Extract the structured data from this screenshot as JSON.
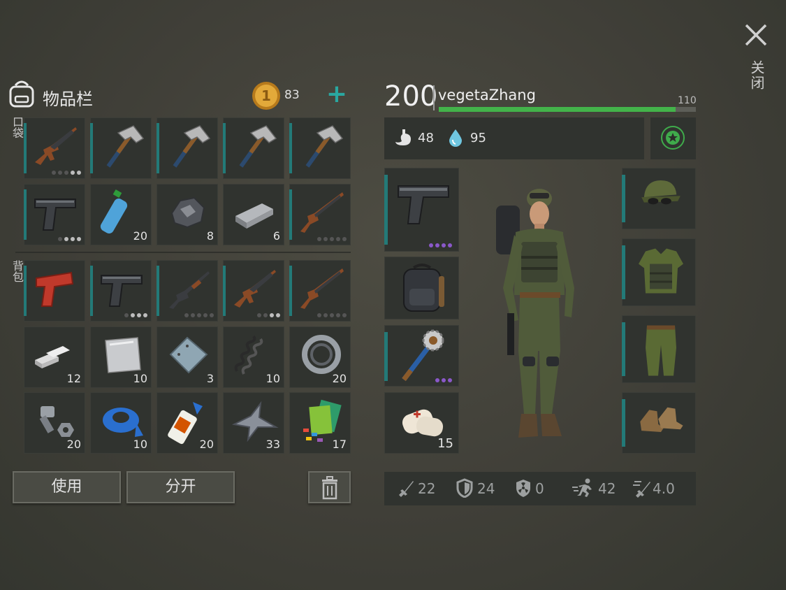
{
  "inventory": {
    "title": "物品栏",
    "coins": "83",
    "pocket_label": "口袋",
    "backpack_label": "背包",
    "slots": [
      {
        "item": "ak-rifle-icon",
        "qty": "",
        "dots": [
          0,
          0,
          0,
          1,
          1
        ]
      },
      {
        "item": "hatchet-icon",
        "qty": "",
        "dots": []
      },
      {
        "item": "hatchet-icon",
        "qty": "",
        "dots": []
      },
      {
        "item": "hatchet-icon",
        "qty": "",
        "dots": []
      },
      {
        "item": "hatchet-icon",
        "qty": "",
        "dots": []
      },
      {
        "item": "pistol-icon",
        "qty": "",
        "dots": [
          0,
          1,
          1,
          1
        ]
      },
      {
        "item": "water-bottle-icon",
        "qty": "20",
        "dots": []
      },
      {
        "item": "iron-ore-icon",
        "qty": "8",
        "dots": []
      },
      {
        "item": "metal-ingot-icon",
        "qty": "6",
        "dots": []
      },
      {
        "item": "shotgun-icon",
        "qty": "",
        "dots": [
          0,
          0,
          0,
          0,
          0
        ]
      },
      {
        "item": "flare-gun-icon",
        "qty": "",
        "dots": []
      },
      {
        "item": "pistol-icon",
        "qty": "",
        "dots": [
          0,
          1,
          1,
          1
        ]
      },
      {
        "item": "pump-shotgun-icon",
        "qty": "",
        "dots": [
          0,
          0,
          0,
          0,
          0
        ]
      },
      {
        "item": "ak-rifle-icon",
        "qty": "",
        "dots": [
          0,
          0,
          1,
          1
        ]
      },
      {
        "item": "shotgun-icon",
        "qty": "",
        "dots": [
          0,
          0,
          0,
          0,
          0
        ]
      },
      {
        "item": "aluminum-bars-icon",
        "qty": "12",
        "dots": []
      },
      {
        "item": "metal-sheet-icon",
        "qty": "10",
        "dots": []
      },
      {
        "item": "steel-plate-icon",
        "qty": "3",
        "dots": []
      },
      {
        "item": "spring-icon",
        "qty": "10",
        "dots": []
      },
      {
        "item": "bearing-icon",
        "qty": "20",
        "dots": []
      },
      {
        "item": "bolt-nut-icon",
        "qty": "20",
        "dots": []
      },
      {
        "item": "duct-tape-icon",
        "qty": "10",
        "dots": []
      },
      {
        "item": "glue-icon",
        "qty": "20",
        "dots": []
      },
      {
        "item": "metal-scrap-icon",
        "qty": "33",
        "dots": []
      },
      {
        "item": "cloth-and-wires-icon",
        "qty": "17",
        "dots": []
      }
    ],
    "use_button": "使用",
    "split_button": "分开"
  },
  "character": {
    "level": "200",
    "name": "vegetaZhang",
    "xp_value": "110",
    "xp_fraction": 0.92,
    "food": "48",
    "water": "95",
    "quick_slots": [
      {
        "item": "pistol-icon",
        "qty": "",
        "purple_dots": 4
      },
      {
        "item": "backpack-icon",
        "qty": "",
        "purple_dots": 0
      },
      {
        "item": "spiked-club-icon",
        "qty": "",
        "purple_dots": 3
      },
      {
        "item": "bandage-icon",
        "qty": "15",
        "purple_dots": 0
      }
    ],
    "armor_slots": [
      "camo-cap-icon",
      "camo-vest-icon",
      "camo-pants-icon",
      "boots-icon"
    ],
    "stats": {
      "attack": "22",
      "defense": "24",
      "radiation": "0",
      "speed": "42",
      "attack_speed": "4.0"
    }
  },
  "close_label": "关闭",
  "colors": {
    "accent": "#237a78",
    "xp": "#43b34a",
    "plus": "#2aa7a0",
    "rare": "#8a58c9"
  }
}
